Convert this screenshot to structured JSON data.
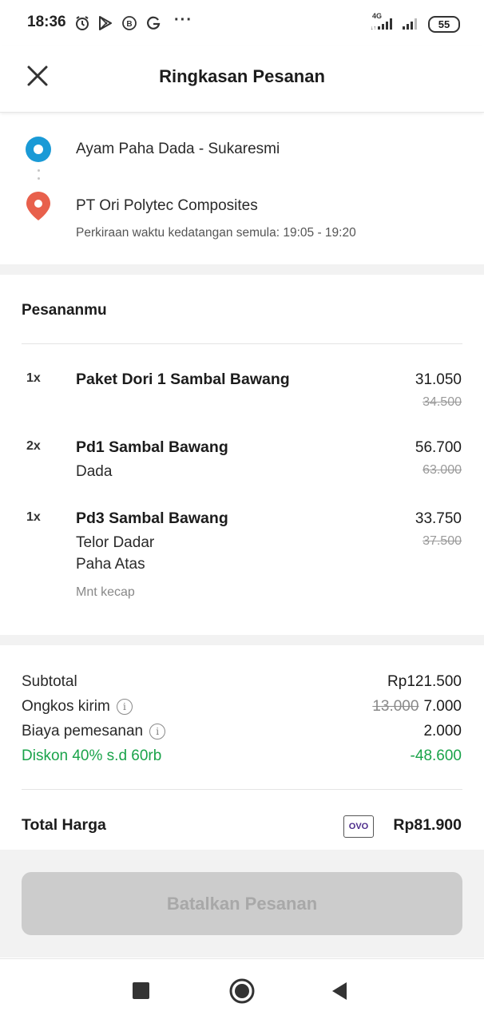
{
  "status_bar": {
    "time": "18:36",
    "dots": "···",
    "network_label": "4G",
    "battery": "55",
    "icons": [
      "alarm-icon",
      "play-store-icon",
      "b-icon",
      "google-icon",
      "signal-icon",
      "signal-icon-2"
    ]
  },
  "header": {
    "title": "Ringkasan Pesanan",
    "close_icon": "close-icon"
  },
  "route": {
    "origin": "Ayam Paha Dada - Sukaresmi",
    "destination": "PT Ori Polytec Composites",
    "eta": "Perkiraan waktu kedatangan semula: 19:05 - 19:20",
    "origin_color": "#1a9ad6",
    "destination_color": "#e8604c"
  },
  "order": {
    "title": "Pesananmu",
    "items": [
      {
        "qty": "1x",
        "name": "Paket Dori 1 Sambal Bawang",
        "price": "31.050",
        "old_price": "34.500"
      },
      {
        "qty": "2x",
        "name": "Pd1 Sambal Bawang",
        "variant": "Dada",
        "price": "56.700",
        "old_price": "63.000"
      },
      {
        "qty": "1x",
        "name": "Pd3 Sambal Bawang",
        "variant_1": "Telor Dadar",
        "variant_2": "Paha Atas",
        "note": "Mnt kecap",
        "price": "33.750",
        "old_price": "37.500"
      }
    ]
  },
  "summary": {
    "subtotal_label": "Subtotal",
    "subtotal_value": "Rp121.500",
    "delivery_label": "Ongkos kirim",
    "delivery_old": "13.000",
    "delivery_value": "7.000",
    "fee_label": "Biaya pemesanan",
    "fee_value": "2.000",
    "discount_label": "Diskon 40% s.d 60rb",
    "discount_value": "-48.600",
    "discount_color": "#1aa34a",
    "info_glyph": "i"
  },
  "total": {
    "label": "Total Harga",
    "payment_method": "OVO",
    "value": "Rp81.900"
  },
  "actions": {
    "cancel_label": "Batalkan Pesanan"
  },
  "navbar": {
    "icons": [
      "square-nav-icon",
      "home-circle-icon",
      "back-triangle-icon"
    ]
  }
}
